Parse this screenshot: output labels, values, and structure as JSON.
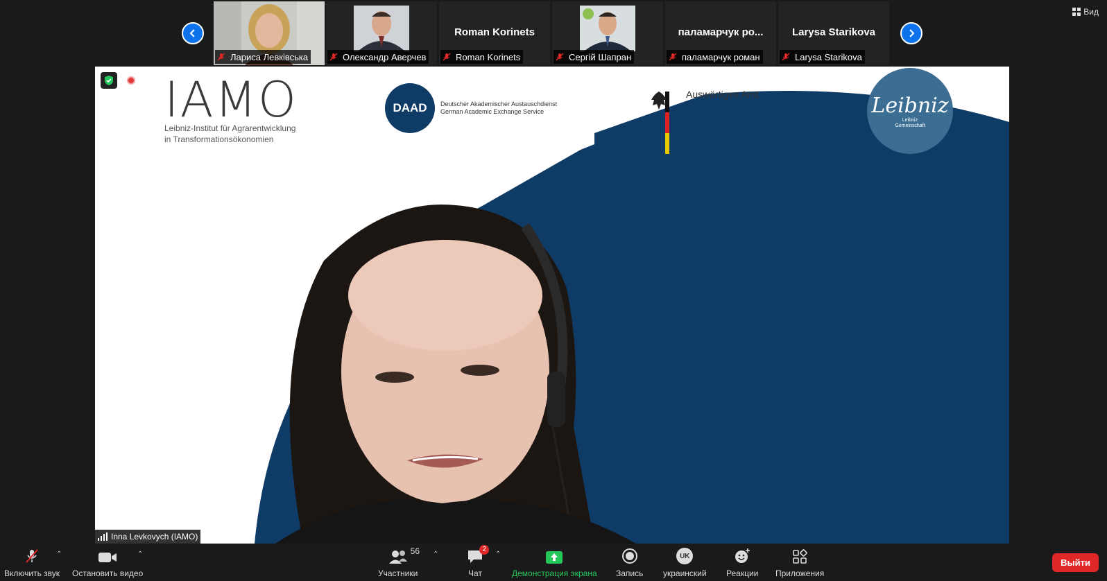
{
  "top_bar": {
    "view_label": "Вид",
    "participants": [
      {
        "display_name": "",
        "label": "Лариса Левківська",
        "has_video": true
      },
      {
        "display_name": "",
        "label": "Олександр Аверчев",
        "has_video": true
      },
      {
        "display_name": "Roman Korinets",
        "label": "Roman Korinets",
        "has_video": false
      },
      {
        "display_name": "",
        "label": "Сергій Шапран",
        "has_video": true
      },
      {
        "display_name": "паламарчук ро...",
        "label": "паламарчук роман",
        "has_video": false
      },
      {
        "display_name": "Larysa Starikova",
        "label": "Larysa Starikova",
        "has_video": false
      }
    ]
  },
  "slide": {
    "iamo_logo": "IAMO",
    "iamo_subtitle_1": "Leibniz-Institut für Agrarentwicklung",
    "iamo_subtitle_2": "in Transformationsökonomien",
    "daad_logo": "DAAD",
    "daad_text_1": "Deutscher Akademischer Austauschdienst",
    "daad_text_2": "German Academic Exchange Service",
    "aa_text": "Auswärtiges Amt",
    "leibniz_logo": "Leibniz",
    "leibniz_sub_1": "Leibniz",
    "leibniz_sub_2": "Gemeinschaft"
  },
  "speaker": {
    "label": "Inna Levkovych (IAMO)"
  },
  "toolbar": {
    "unmute_label": "Включить звук",
    "stop_video_label": "Остановить видео",
    "participants_label": "Участники",
    "participants_count": "56",
    "chat_label": "Чат",
    "chat_badge": "2",
    "share_label": "Демонстрация экрана",
    "record_label": "Запись",
    "language_label": "украинский",
    "language_code": "UK",
    "reactions_label": "Реакции",
    "apps_label": "Приложения",
    "leave_label": "Выйти"
  },
  "colors": {
    "accent_blue": "#0e72ed",
    "slide_navy": "#0f3b67",
    "leave_red": "#e02828",
    "share_green": "#25c75b"
  }
}
